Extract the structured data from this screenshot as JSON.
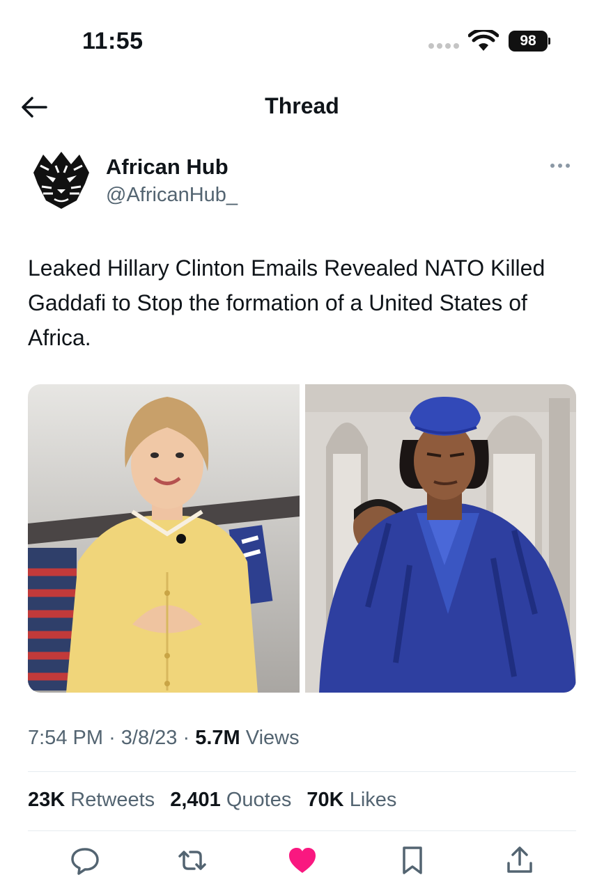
{
  "status_bar": {
    "time": "11:55",
    "battery": "98"
  },
  "header": {
    "title": "Thread"
  },
  "author": {
    "name": "African Hub",
    "handle": "@AfricanHub_"
  },
  "tweet": {
    "text": "Leaked Hillary Clinton Emails Revealed NATO Killed Gaddafi to Stop the formation of a United States of Africa.",
    "time": "7:54 PM",
    "date": "3/8/23",
    "views_count": "5.7M",
    "views_label": "Views",
    "separator": "·"
  },
  "stats": {
    "retweets_count": "23K",
    "retweets_label": "Retweets",
    "quotes_count": "2,401",
    "quotes_label": "Quotes",
    "likes_count": "70K",
    "likes_label": "Likes"
  },
  "colors": {
    "accent": "#1d9bf0",
    "liked": "#f91880",
    "secondary_text": "#536471",
    "icon": "#536471"
  },
  "icons": [
    "back-arrow-icon",
    "wifi-icon",
    "battery-icon",
    "more-icon",
    "reply-icon",
    "retweet-icon",
    "like-icon",
    "bookmark-icon",
    "share-icon"
  ]
}
